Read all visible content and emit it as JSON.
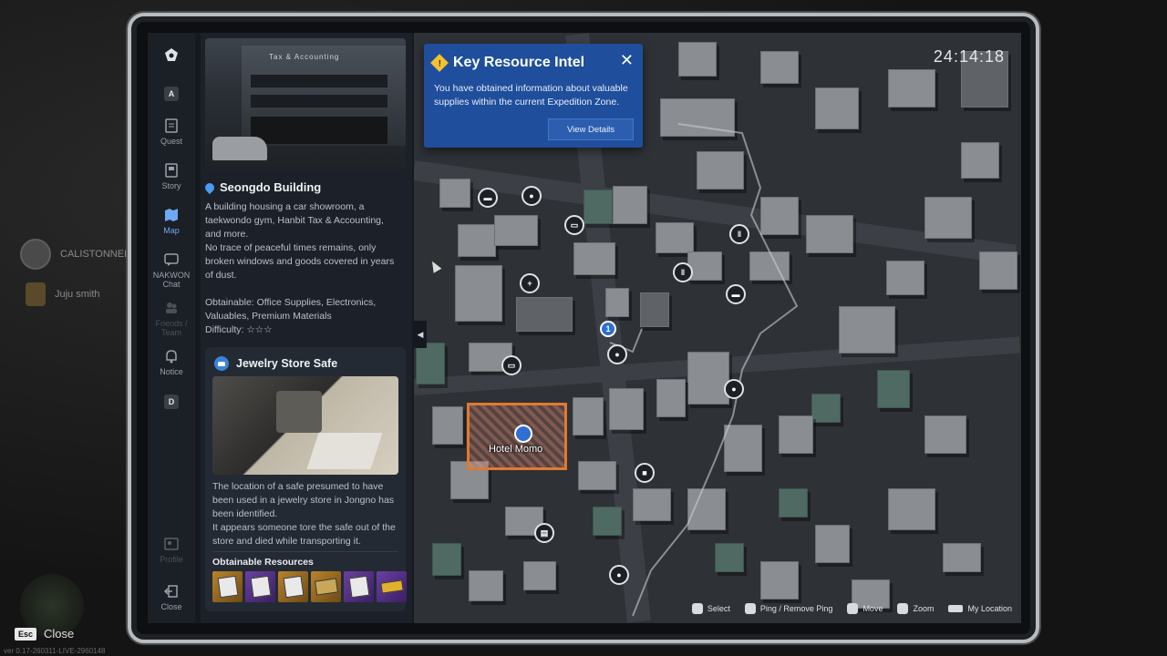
{
  "background": {
    "players": [
      {
        "name": "CALISTONNER"
      },
      {
        "name": "Juju smith"
      }
    ],
    "esc_key": "Esc",
    "esc_label": "Close",
    "version": "ver 0.17-260311-LIVE-2960148"
  },
  "nav": {
    "top_chip": "A",
    "items": [
      {
        "label": "Quest",
        "icon": "quest-icon"
      },
      {
        "label": "Story",
        "icon": "story-icon"
      },
      {
        "label": "Map",
        "icon": "map-icon",
        "active": true
      },
      {
        "label": "NAKWON Chat",
        "icon": "chat-icon"
      },
      {
        "label": "Friends / Team",
        "icon": "friends-icon",
        "disabled": true
      },
      {
        "label": "Notice",
        "icon": "bell-icon"
      }
    ],
    "bottom_chip": "D",
    "profile_label": "Profile",
    "close_label": "Close"
  },
  "location": {
    "photo_sign": "Tax & Accounting",
    "name": "Seongdo Building",
    "description_1": "A building housing a car showroom, a taekwondo gym, Hanbit Tax & Accounting, and more.",
    "description_2": "No trace of peaceful times remains, only broken windows and goods covered in years of dust.",
    "obtainable": "Obtainable: Office Supplies, Electronics, Valuables, Premium Materials",
    "difficulty_label": "Difficulty:",
    "difficulty_stars": "☆☆☆"
  },
  "poi_card": {
    "title": "Jewelry Store Safe",
    "description_1": "The location of a safe presumed to have been used in a jewelry store in Jongno has been identified.",
    "description_2": "It appears someone tore the safe out of the store and died while transporting it.",
    "resources_title": "Obtainable Resources",
    "resources": [
      {
        "icon": "gold-case-icon",
        "tier": "gold"
      },
      {
        "icon": "purple-case-icon",
        "tier": "purple"
      },
      {
        "icon": "gold-case-icon",
        "tier": "gold"
      },
      {
        "icon": "gold-box-icon",
        "tier": "gold"
      },
      {
        "icon": "purple-case-icon",
        "tier": "purple"
      },
      {
        "icon": "purple-bar-icon",
        "tier": "purple"
      }
    ]
  },
  "map": {
    "clock": "24:14:18",
    "hotel_label": "Hotel Momo",
    "waypoint": "1"
  },
  "intel": {
    "title": "Key Resource Intel",
    "body": "You have obtained information about valuable supplies within the current Expedition Zone.",
    "button": "View Details",
    "close": "✕"
  },
  "hints": [
    {
      "label": "Select"
    },
    {
      "label": "Ping / Remove Ping"
    },
    {
      "label": "Move"
    },
    {
      "label": "Zoom"
    },
    {
      "label": "My Location"
    }
  ]
}
